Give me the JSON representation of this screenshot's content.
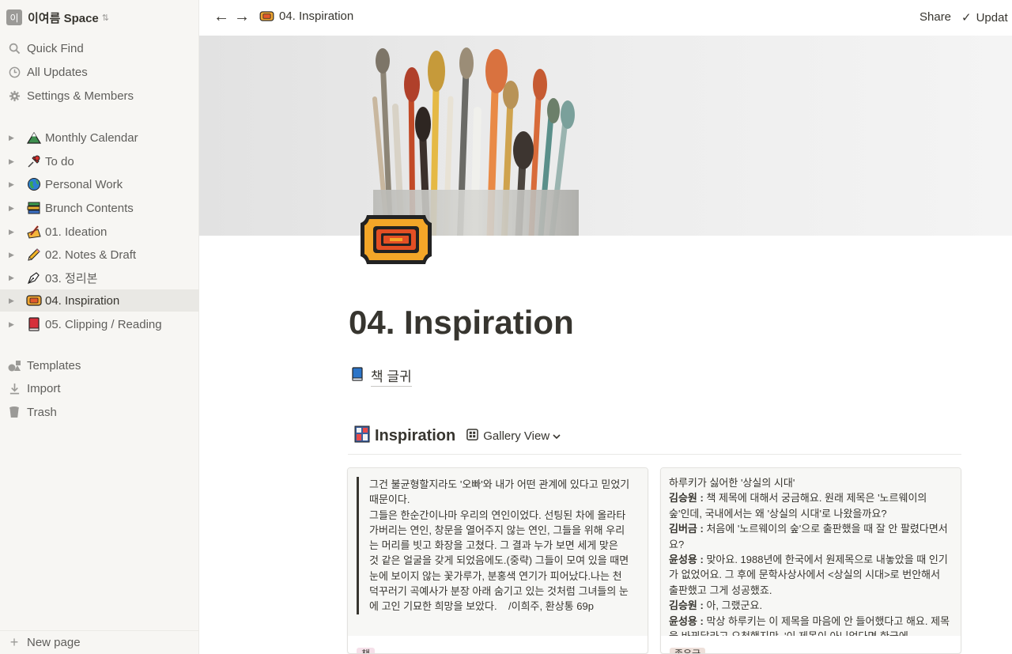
{
  "workspace": {
    "badge": "이",
    "name": "이여름 Space"
  },
  "sidebar": {
    "nav": [
      {
        "label": "Quick Find",
        "icon": "search-icon"
      },
      {
        "label": "All Updates",
        "icon": "clock-icon"
      },
      {
        "label": "Settings & Members",
        "icon": "gear-icon"
      }
    ],
    "pages": [
      {
        "label": "Monthly Calendar",
        "icon": "mountain-icon"
      },
      {
        "label": "To do",
        "icon": "pushpin-icon"
      },
      {
        "label": "Personal Work",
        "icon": "globe-icon"
      },
      {
        "label": "Brunch Contents",
        "icon": "books-icon"
      },
      {
        "label": "01. Ideation",
        "icon": "memo-icon"
      },
      {
        "label": "02. Notes & Draft",
        "icon": "pencil-icon"
      },
      {
        "label": "03. 정리본",
        "icon": "fountain-pen-icon"
      },
      {
        "label": "04. Inspiration",
        "icon": "ticket-icon",
        "active": true
      },
      {
        "label": "05. Clipping / Reading",
        "icon": "red-book-icon"
      }
    ],
    "bottom": [
      {
        "label": "Templates",
        "icon": "shapes-icon"
      },
      {
        "label": "Import",
        "icon": "download-icon"
      },
      {
        "label": "Trash",
        "icon": "trash-icon"
      }
    ],
    "new_page": "New page"
  },
  "topbar": {
    "breadcrumb": "04. Inspiration",
    "share": "Share",
    "updates": "Updat"
  },
  "page": {
    "title": "04. Inspiration",
    "link_label": "책 글귀",
    "database": {
      "title": "Inspiration",
      "view": "Gallery View"
    }
  },
  "cards": [
    {
      "quote": "그건 불균형할지라도 '오빠'와 내가 어떤 관계에 있다고 믿었기 때문이다.\n그들은 한순간이나마 우리의 연인이었다. 선팅된 차에 올라타 가버리는 연인, 창문을 열어주지 않는 연인, 그들을 위해 우리는 머리를 빗고 화장을 고쳤다. 그 결과 누가 보면 세게 맞은 것 같은 얼굴을 갖게 되었음에도.(중략) 그들이 모여 있을 때면 눈에 보이지 않는 꽃가루가, 분홍색 연기가 피어났다.나는 천덕꾸러기 곡예사가 분장 아래 숨기고 있는 것처럼 그녀들의 눈에 고인 기묘한 희망을 보았다.    /이희주, 환상통 69p",
      "tag": "책"
    },
    {
      "lines": [
        {
          "speaker": "",
          "text": "하루키가 싫어한 '상실의 시대'"
        },
        {
          "speaker": "김승원 : ",
          "text": "책 제목에 대해서 궁금해요. 원래 제목은 '노르웨이의 숲'인데, 국내에서는 왜 '상실의 시대'로 나왔을까요?"
        },
        {
          "speaker": "김버금 : ",
          "text": "처음에 '노르웨이의 숲'으로 출판했을 때 잘 안 팔렸다면서요?"
        },
        {
          "speaker": "윤성용 : ",
          "text": "맞아요. 1988년에 한국에서 원제목으로 내놓았을 때 인기가 없었어요. 그 후에 문학사상사에서 <상실의 시대>로 번안해서 출판했고 그게 성공했죠."
        },
        {
          "speaker": "김승원 : ",
          "text": "아, 그랬군요."
        },
        {
          "speaker": "윤성용 : ",
          "text": "막상 하루키는 이 제목을 마음에 안 들어했다고 해요. 제목을 바꿔달라고 요청했지만, '이 제목이 아니었다면 한국에"
        }
      ],
      "tag": "좋은글"
    }
  ],
  "colors": {
    "sidebar_bg": "#f7f6f3",
    "active_bg": "#e9e8e4",
    "tag_pink": "#f5e0e9",
    "tag_brown": "#eee0da"
  }
}
